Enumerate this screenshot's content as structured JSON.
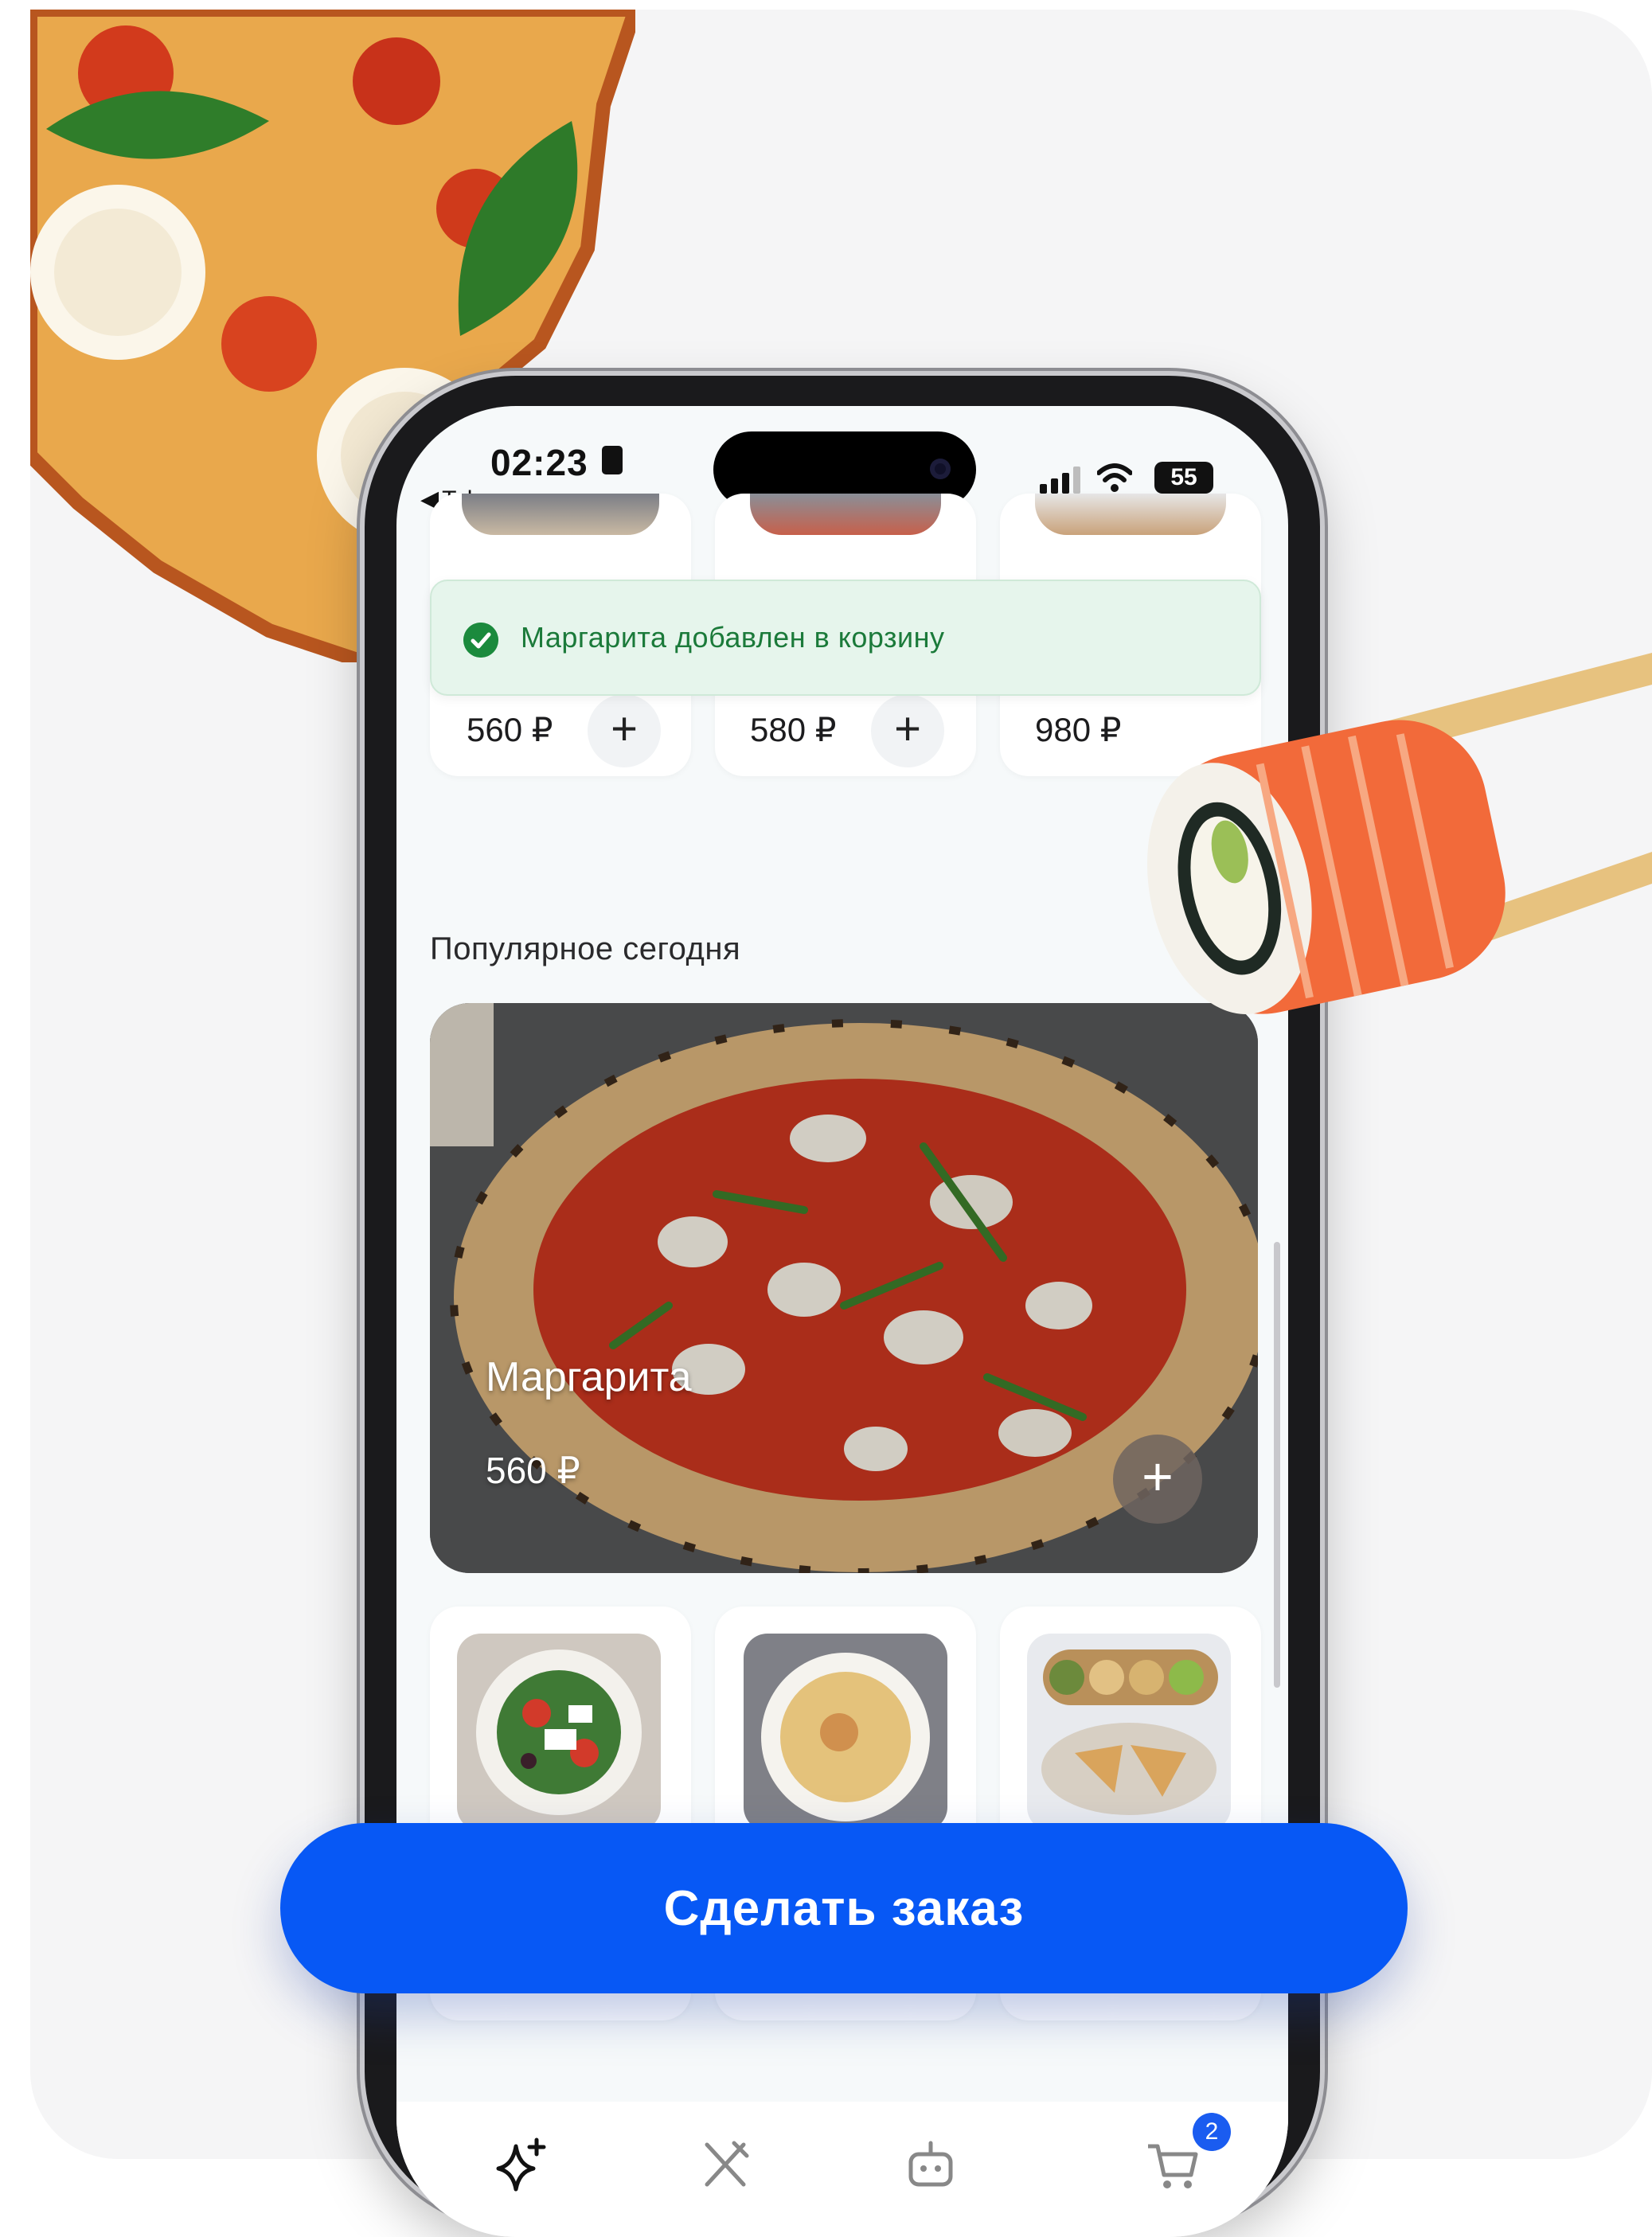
{
  "status_bar": {
    "time": "02:23",
    "back_app": "Telegram",
    "battery": "55"
  },
  "toast": {
    "message": "Маргарита добавлен в корзину"
  },
  "top_row": {
    "prices": [
      "560 ₽",
      "580 ₽",
      "980 ₽"
    ]
  },
  "popular": {
    "title": "Популярное сегодня",
    "item_name": "Маргарита",
    "item_price": "560 ₽"
  },
  "cart": {
    "count": "2"
  },
  "order_button": {
    "label": "Сделать заказ"
  },
  "tabs": [
    "sparkles-icon",
    "utensils-icon",
    "robot-icon",
    "cart-icon"
  ],
  "colors": {
    "accent": "#0758f5",
    "toast_bg": "#e6f5ec",
    "toast_text": "#1b7a3a",
    "badge": "#1a5cf0"
  }
}
